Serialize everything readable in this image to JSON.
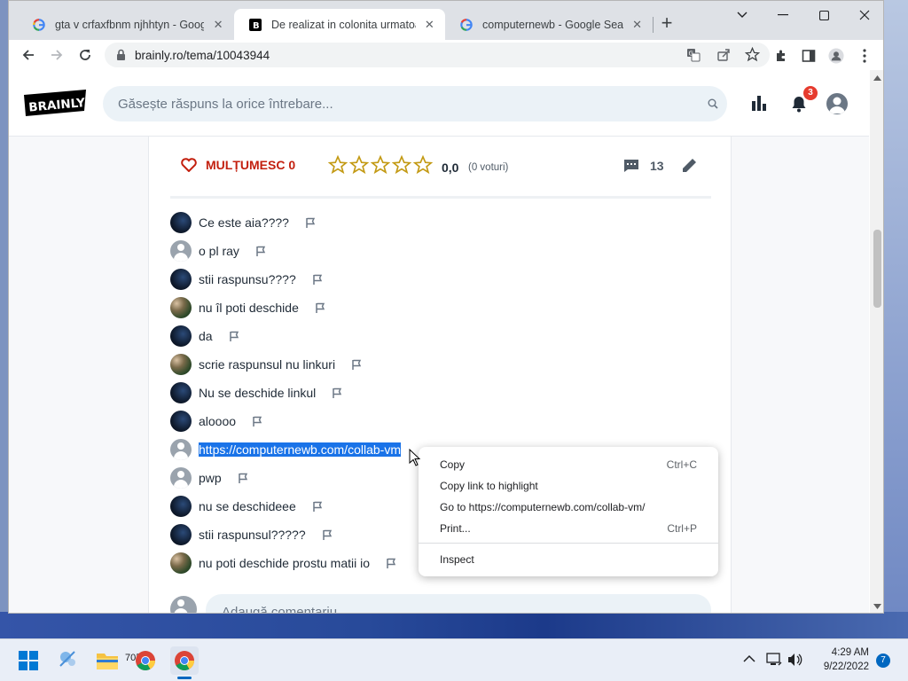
{
  "browser": {
    "tabs": [
      {
        "title": "gta v crfaxfbnm njhhtyn - Google Search",
        "active": false
      },
      {
        "title": "De realizat in colonita urmatoarea tabelu",
        "active": true
      },
      {
        "title": "computernewb - Google Search",
        "active": false
      }
    ],
    "url": "brainly.ro/tema/10043944"
  },
  "site": {
    "search_placeholder": "Găsește răspuns la orice întrebare...",
    "notifications_count": "3",
    "logo_text": "BRAINLY"
  },
  "answer_actions": {
    "thanks_label": "MULȚUMESC 0",
    "rating": "0,0",
    "votes": "(0 voturi)",
    "comment_count": "13"
  },
  "comments": [
    {
      "text": "Ce este aia????",
      "avatar": "dark"
    },
    {
      "text": "o pl ray",
      "avatar": "grey"
    },
    {
      "text": "stii raspunsu????",
      "avatar": "dark"
    },
    {
      "text": "nu îl poti deschide",
      "avatar": "photo"
    },
    {
      "text": "da",
      "avatar": "dark"
    },
    {
      "text": "scrie raspunsul nu linkuri",
      "avatar": "photo"
    },
    {
      "text": "Nu se deschide linkul",
      "avatar": "dark"
    },
    {
      "text": "aloooo",
      "avatar": "dark"
    },
    {
      "text": "https://computernewb.com/collab-vm",
      "avatar": "grey"
    },
    {
      "text": "pwp",
      "avatar": "grey"
    },
    {
      "text": "nu se deschideee",
      "avatar": "dark"
    },
    {
      "text": "stii raspunsul?????",
      "avatar": "dark"
    },
    {
      "text": "nu poti deschide prostu matii io",
      "avatar": "photo"
    }
  ],
  "add_comment_placeholder": "Adaugă comentariu",
  "context_menu": {
    "items": [
      {
        "label": "Copy",
        "shortcut": "Ctrl+C"
      },
      {
        "label": "Copy link to highlight",
        "shortcut": ""
      },
      {
        "label": "Go to https://computernewb.com/collab-vm/",
        "shortcut": ""
      },
      {
        "label": "Print...",
        "shortcut": "Ctrl+P"
      },
      {
        "label": "Inspect",
        "shortcut": ""
      }
    ]
  },
  "taskbar": {
    "temperature": "70°",
    "time": "4:29 AM",
    "date": "9/22/2022",
    "notification_count": "7"
  },
  "colors": {
    "brand_red": "#c3200f",
    "selection_blue": "#1a73e8",
    "accent_windows": "#0067c0"
  }
}
